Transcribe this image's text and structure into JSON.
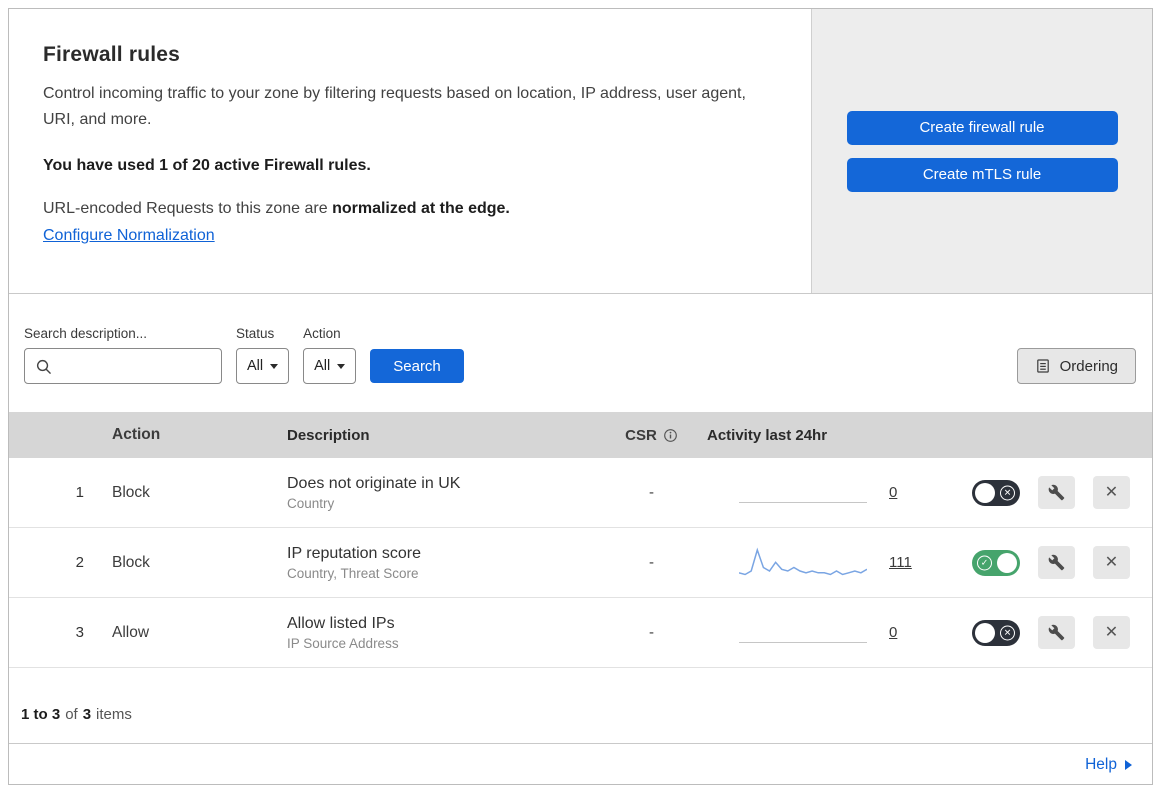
{
  "colors": {
    "primary_blue": "#1467d8",
    "link_blue": "#0f62d6",
    "toggle_on": "#46a46c",
    "toggle_off": "#2c313a",
    "sparkline": "#7aa5e3",
    "table_header_bg": "#d6d6d6",
    "panel_bg": "#ededed"
  },
  "icons": {
    "search": "magnifier",
    "dropdown_caret": "triangle-down",
    "ordering": "document-list",
    "csr_info": "info-circle",
    "edit": "wrench",
    "delete": "x",
    "toggle_on": "check-in-circle",
    "toggle_off": "x-in-circle",
    "help": "triangle-right"
  },
  "header": {
    "title": "Firewall rules",
    "description": "Control incoming traffic to your zone by filtering requests based on location, IP address, user agent, URI, and more.",
    "usage_bold": "You have used 1 of 20 active Firewall rules.",
    "normalization_prefix": "URL-encoded Requests to this zone are ",
    "normalization_bold": "normalized at the edge.",
    "normalization_link": "Configure Normalization",
    "actions": {
      "create_firewall_rule": "Create firewall rule",
      "create_mtls_rule": "Create mTLS rule"
    }
  },
  "filters": {
    "search_label": "Search description...",
    "search_value": "",
    "status_label": "Status",
    "status_value": "All",
    "action_label": "Action",
    "action_value": "All",
    "search_button": "Search",
    "ordering_button": "Ordering"
  },
  "table": {
    "columns": {
      "action": "Action",
      "description": "Description",
      "csr": "CSR",
      "activity": "Activity last 24hr"
    },
    "rows": [
      {
        "index": "1",
        "action": "Block",
        "description": "Does not originate in UK",
        "fields": "Country",
        "csr": "-",
        "activity_count": "0",
        "enabled": false
      },
      {
        "index": "2",
        "action": "Block",
        "description": "IP reputation score",
        "fields": "Country, Threat Score",
        "csr": "-",
        "activity_count": "111",
        "enabled": true,
        "sparkline": [
          3,
          2,
          4,
          16,
          6,
          4,
          9,
          5,
          4,
          6,
          4,
          3,
          4,
          3,
          3,
          2,
          4,
          2,
          3,
          4,
          3,
          5
        ]
      },
      {
        "index": "3",
        "action": "Allow",
        "description": "Allow listed IPs",
        "fields": "IP Source Address",
        "csr": "-",
        "activity_count": "0",
        "enabled": false
      }
    ]
  },
  "footer": {
    "range_bold": "1 to 3",
    "of_text": "of",
    "total_bold": "3",
    "items_text": "items",
    "help": "Help"
  }
}
